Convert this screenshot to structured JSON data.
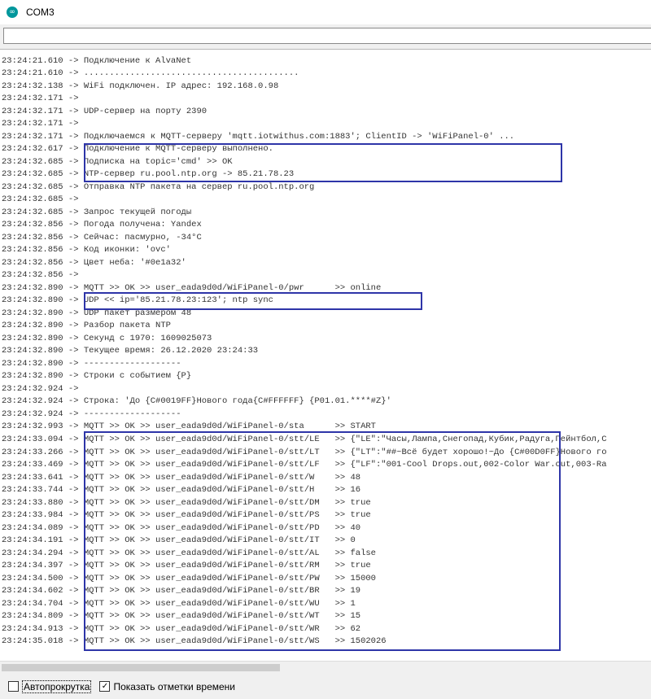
{
  "window": {
    "title": "COM3",
    "icon": "arduino-icon"
  },
  "send_input": {
    "value": ""
  },
  "log_lines": [
    "23:24:21.610 ->",
    "23:24:21.610 -> Подключение к AlvaNet",
    "23:24:21.610 -> ..........................................",
    "23:24:32.138 -> WiFi подключен. IP адрес: 192.168.0.98",
    "23:24:32.171 ->",
    "23:24:32.171 -> UDP-сервер на порту 2390",
    "23:24:32.171 ->",
    "23:24:32.171 -> Подключаемся к MQTT-серверу 'mqtt.iotwithus.com:1883'; ClientID -> 'WiFiPanel-0' ...",
    "23:24:32.617 -> Подключение к MQTT-серверу выполнено.",
    "23:24:32.685 -> Подписка на topic='cmd' >> OK",
    "23:24:32.685 -> NTP-сервер ru.pool.ntp.org -> 85.21.78.23",
    "23:24:32.685 -> Отправка NTP пакета на сервер ru.pool.ntp.org",
    "23:24:32.685 ->",
    "23:24:32.685 -> Запрос текущей погоды",
    "23:24:32.856 -> Погода получена: Yandex",
    "23:24:32.856 -> Сейчас: пасмурно, -34°C",
    "23:24:32.856 -> Код иконки: 'ovc'",
    "23:24:32.856 -> Цвет неба: '#0e1a32'",
    "23:24:32.856 ->",
    "23:24:32.890 -> MQTT >> OK >> user_eada9d0d/WiFiPanel-0/pwr      >> online",
    "23:24:32.890 -> UDP << ip='85.21.78.23:123'; ntp sync",
    "23:24:32.890 -> UDP пакет размером 48",
    "23:24:32.890 -> Разбор пакета NTP",
    "23:24:32.890 -> Секунд с 1970: 1609025073",
    "23:24:32.890 -> Текущее время: 26.12.2020 23:24:33",
    "23:24:32.890 -> -------------------",
    "23:24:32.890 -> Строки с событием {P}",
    "23:24:32.924 ->",
    "23:24:32.924 -> Строка: 'До {C#0019FF}Нового года{C#FFFFFF} {P01.01.****#Z}'",
    "23:24:32.924 -> -------------------",
    "23:24:32.993 -> MQTT >> OK >> user_eada9d0d/WiFiPanel-0/sta      >> START",
    "23:24:33.094 -> MQTT >> OK >> user_eada9d0d/WiFiPanel-0/stt/LE   >> {\"LE\":\"Часы,Лампа,Снегопад,Кубик,Радуга,Пейнтбол,С",
    "23:24:33.266 -> MQTT >> OK >> user_eada9d0d/WiFiPanel-0/stt/LT   >> {\"LT\":\"##~Всё будет хорошо!~До {C#00D0FF}Нового го",
    "23:24:33.469 -> MQTT >> OK >> user_eada9d0d/WiFiPanel-0/stt/LF   >> {\"LF\":\"001-Cool Drops.out,002-Color War.out,003-Ra",
    "23:24:33.641 -> MQTT >> OK >> user_eada9d0d/WiFiPanel-0/stt/W    >> 48",
    "23:24:33.744 -> MQTT >> OK >> user_eada9d0d/WiFiPanel-0/stt/H    >> 16",
    "23:24:33.880 -> MQTT >> OK >> user_eada9d0d/WiFiPanel-0/stt/DM   >> true",
    "23:24:33.984 -> MQTT >> OK >> user_eada9d0d/WiFiPanel-0/stt/PS   >> true",
    "23:24:34.089 -> MQTT >> OK >> user_eada9d0d/WiFiPanel-0/stt/PD   >> 40",
    "23:24:34.191 -> MQTT >> OK >> user_eada9d0d/WiFiPanel-0/stt/IT   >> 0",
    "23:24:34.294 -> MQTT >> OK >> user_eada9d0d/WiFiPanel-0/stt/AL   >> false",
    "23:24:34.397 -> MQTT >> OK >> user_eada9d0d/WiFiPanel-0/stt/RM   >> true",
    "23:24:34.500 -> MQTT >> OK >> user_eada9d0d/WiFiPanel-0/stt/PW   >> 15000",
    "23:24:34.602 -> MQTT >> OK >> user_eada9d0d/WiFiPanel-0/stt/BR   >> 19",
    "23:24:34.704 -> MQTT >> OK >> user_eada9d0d/WiFiPanel-0/stt/WU   >> 1",
    "23:24:34.809 -> MQTT >> OK >> user_eada9d0d/WiFiPanel-0/stt/WT   >> 15",
    "23:24:34.913 -> MQTT >> OK >> user_eada9d0d/WiFiPanel-0/stt/WR   >> 62",
    "23:24:35.018 -> MQTT >> OK >> user_eada9d0d/WiFiPanel-0/stt/WS   >> 1502026"
  ],
  "highlight_color": "#2e35a8",
  "bottom": {
    "autoscroll": {
      "label": "Автопрокрутка",
      "checked": false
    },
    "timestamps": {
      "label": "Показать отметки времени",
      "checked": true
    }
  }
}
